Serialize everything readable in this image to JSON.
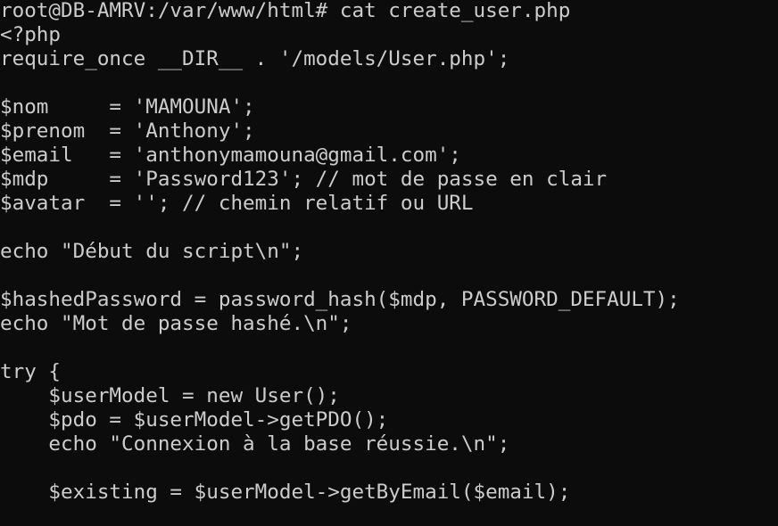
{
  "terminal": {
    "colors": {
      "background": "#0c0c0c",
      "foreground": "#cccccc"
    },
    "lines": [
      "root@DB-AMRV:/var/www/html# cat create_user.php",
      "<?php",
      "require_once __DIR__ . '/models/User.php';",
      "",
      "$nom     = 'MAMOUNA';",
      "$prenom  = 'Anthony';",
      "$email   = 'anthonymamouna@gmail.com';",
      "$mdp     = 'Password123'; // mot de passe en clair",
      "$avatar  = ''; // chemin relatif ou URL",
      "",
      "echo \"Début du script\\n\";",
      "",
      "$hashedPassword = password_hash($mdp, PASSWORD_DEFAULT);",
      "echo \"Mot de passe hashé.\\n\";",
      "",
      "try {",
      "    $userModel = new User();",
      "    $pdo = $userModel->getPDO();",
      "    echo \"Connexion à la base réussie.\\n\";",
      "",
      "    $existing = $userModel->getByEmail($email);"
    ]
  }
}
